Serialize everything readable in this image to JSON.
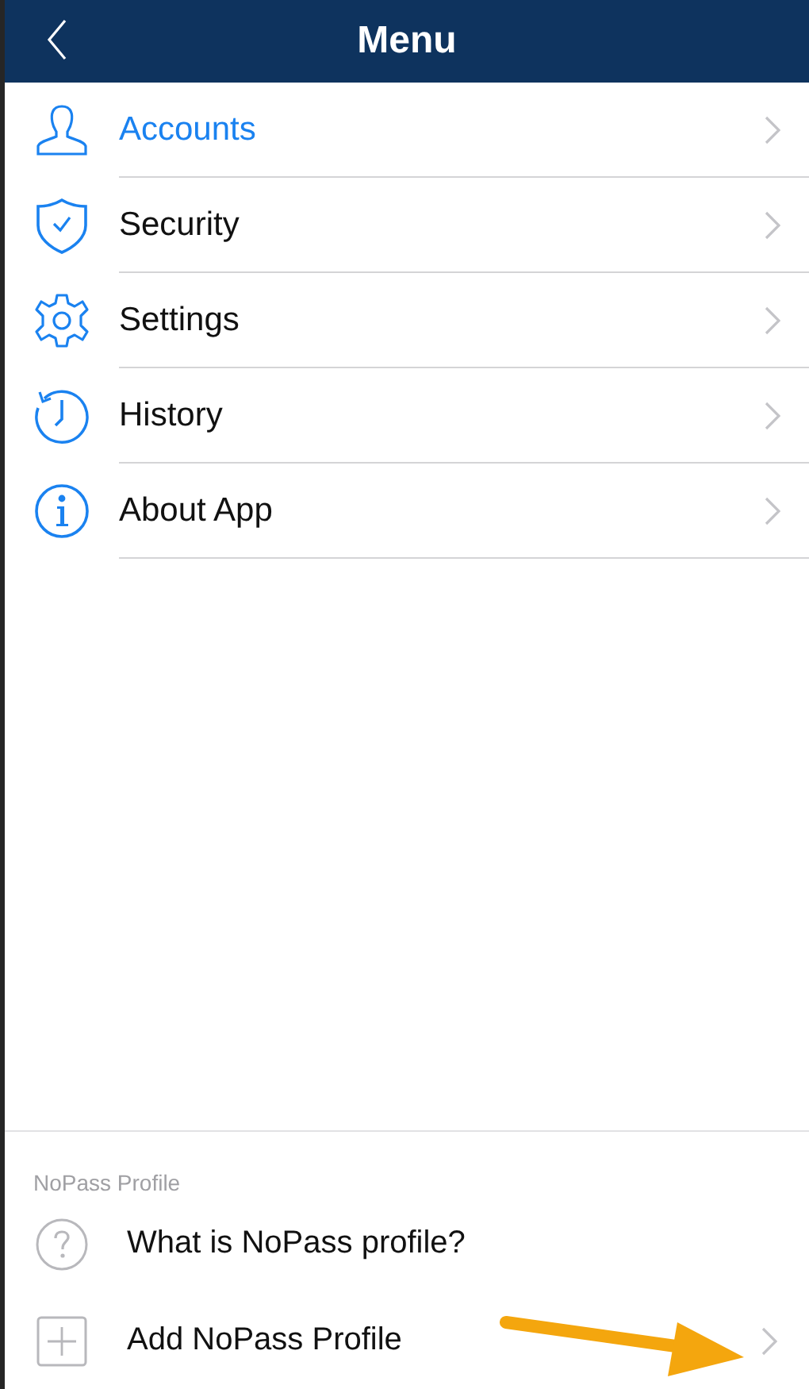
{
  "header": {
    "title": "Menu"
  },
  "menu": [
    {
      "label": "Accounts",
      "selected": true
    },
    {
      "label": "Security",
      "selected": false
    },
    {
      "label": "Settings",
      "selected": false
    },
    {
      "label": "History",
      "selected": false
    },
    {
      "label": "About App",
      "selected": false
    }
  ],
  "nopass": {
    "heading": "NoPass Profile",
    "items": [
      {
        "label": "What is NoPass profile?",
        "chevron": false
      },
      {
        "label": "Add NoPass Profile",
        "chevron": true
      }
    ]
  }
}
